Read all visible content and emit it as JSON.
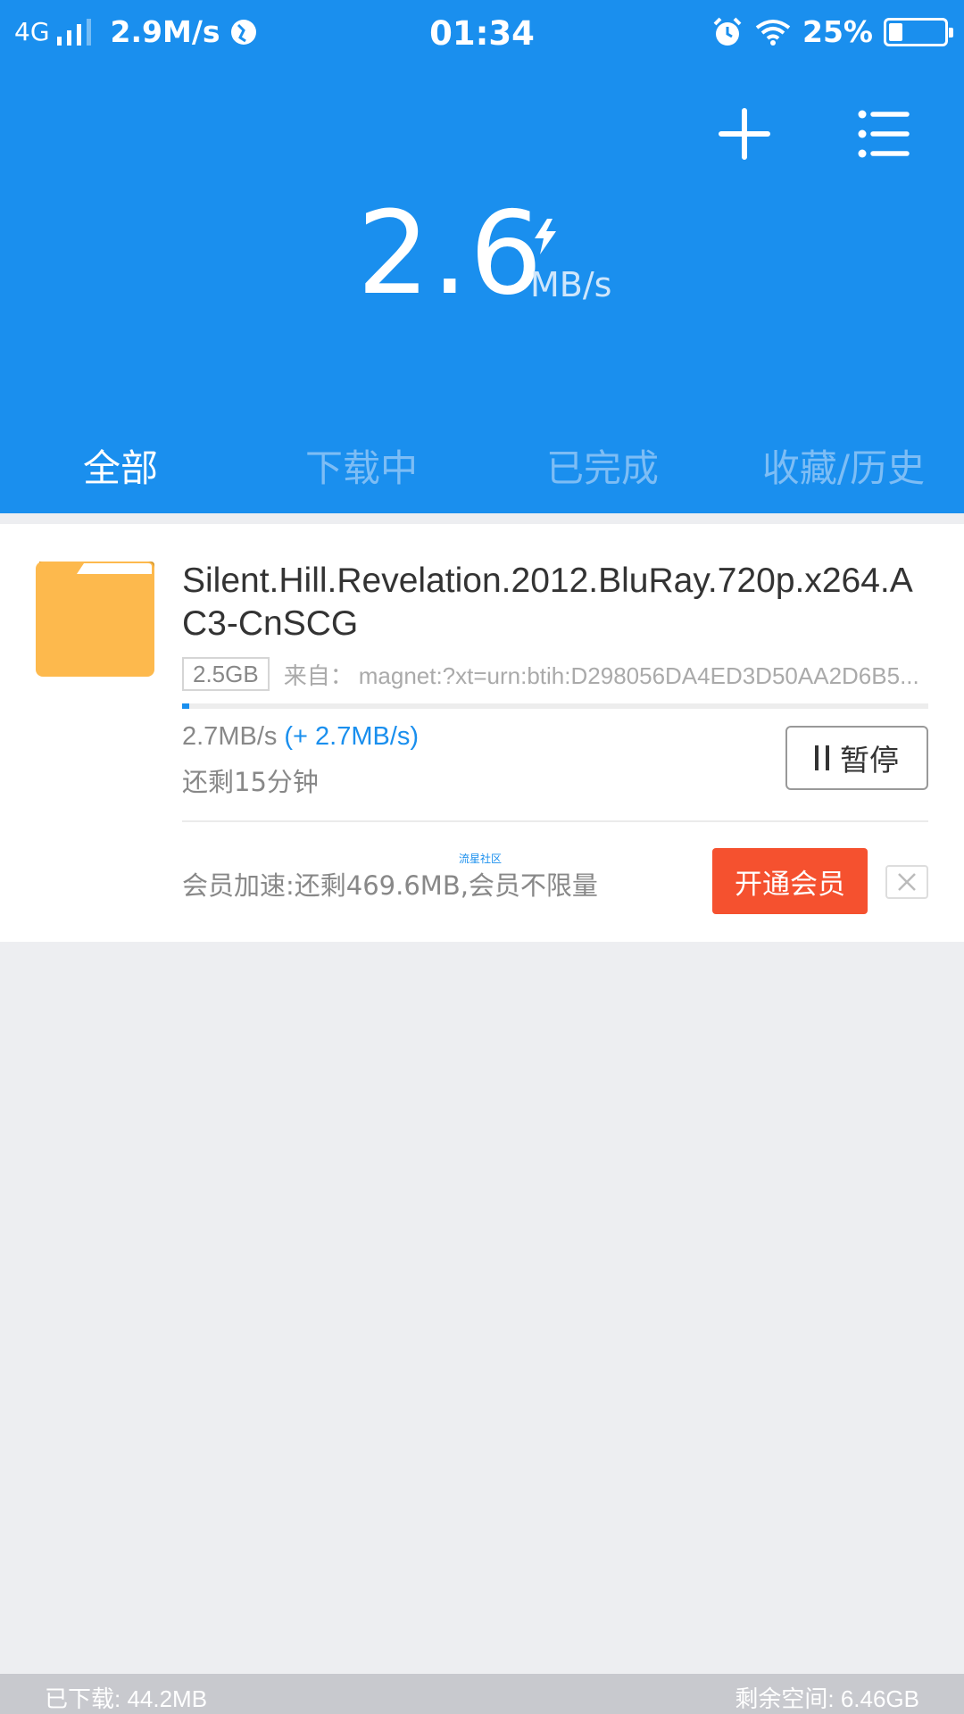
{
  "status_bar": {
    "network": "4G",
    "net_speed": "2.9M/s",
    "time": "01:34",
    "battery": "25%",
    "battery_level": 0.25
  },
  "header": {
    "add_icon": "plus-icon",
    "menu_icon": "list-icon",
    "speed_value": "2.6",
    "speed_unit": "MB/s",
    "speed_icon": "lightning-icon",
    "bg_color": "#1A8FEE"
  },
  "tabs": [
    {
      "label": "全部",
      "active": true
    },
    {
      "label": "下载中",
      "active": false
    },
    {
      "label": "已完成",
      "active": false
    },
    {
      "label": "收藏/历史",
      "active": false
    }
  ],
  "task": {
    "title": "Silent.Hill.Revelation.2012.BluRay.720p.x264.AC3-CnSCG",
    "size": "2.5GB",
    "source_label": "来自：",
    "source": "magnet:?xt=urn:btih:D298056DA4ED3D50AA2D6B5...",
    "progress": 0.01,
    "speed": "2.7MB/s",
    "boost": "(+ 2.7MB/s)",
    "remaining": "还剩15分钟",
    "pause_label": "暂停",
    "watermark": "流星社区",
    "vip_text": "会员加速:还剩469.6MB,会员不限量",
    "vip_button": "开通会员"
  },
  "footer": {
    "downloaded": "已下载: 44.2MB",
    "free_space": "剩余空间: 6.46GB"
  }
}
